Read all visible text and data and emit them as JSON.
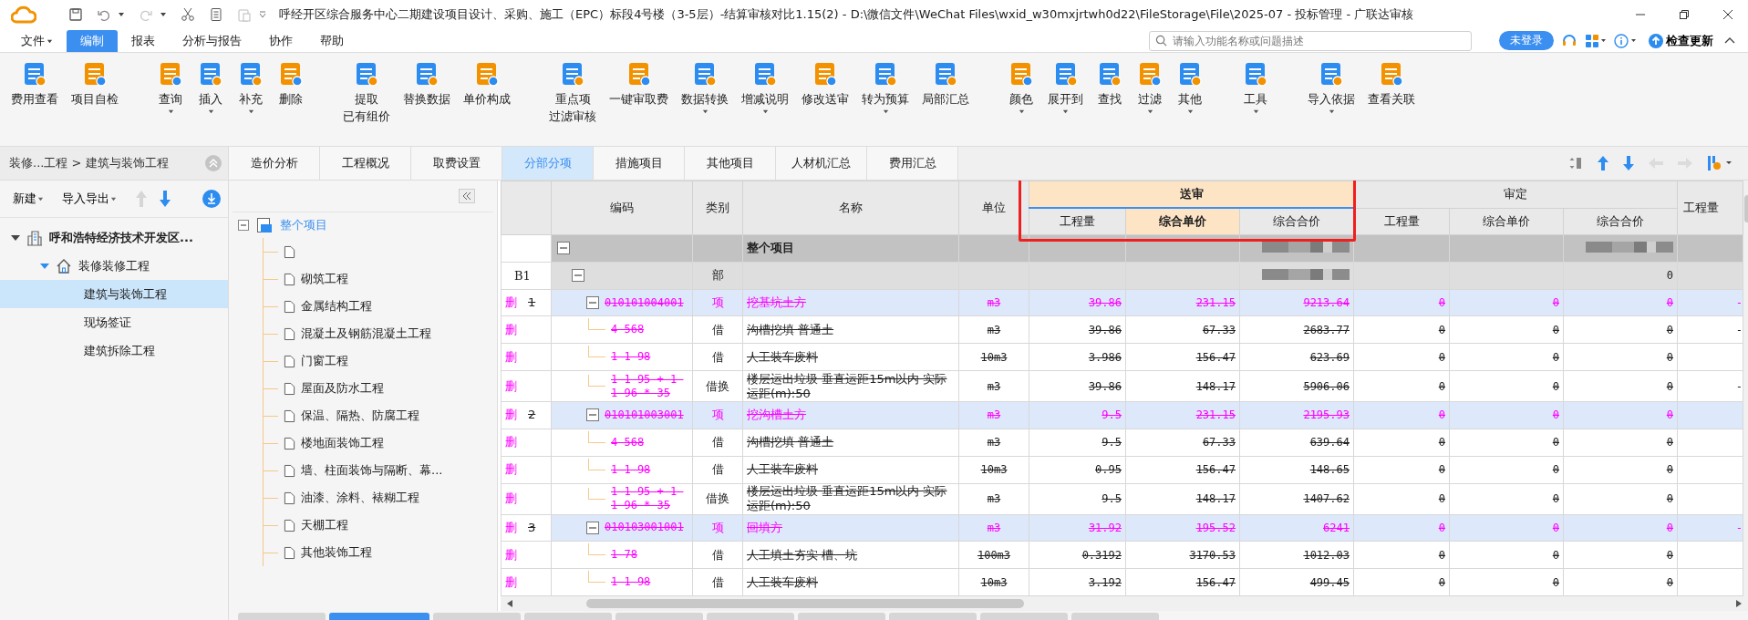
{
  "title_bar": {
    "title": "呼经开区综合服务中心二期建设项目设计、采购、施工（EPC）标段4号楼（3-5层）-结算审核对比1.15(2) - D:\\微信文件\\WeChat Files\\wxid_w30mxjrtwh0d22\\FileStorage\\File\\2025-07 - 投标管理 - 广联达审核",
    "redo_disabled": true
  },
  "menu": [
    {
      "label": "文件",
      "dropdown": true,
      "selected": false
    },
    {
      "label": "编制",
      "dropdown": false,
      "selected": true
    },
    {
      "label": "报表",
      "dropdown": false,
      "selected": false
    },
    {
      "label": "分析与报告",
      "dropdown": false,
      "selected": false
    },
    {
      "label": "协作",
      "dropdown": false,
      "selected": false
    },
    {
      "label": "帮助",
      "dropdown": false,
      "selected": false
    }
  ],
  "search": {
    "placeholder": "请输入功能名称或问题描述"
  },
  "login_button": "未登录",
  "update_button": "检查更新",
  "ribbon_groups": [
    [
      {
        "label": "费用查看",
        "dropdown": false
      },
      {
        "label": "项目自检",
        "dropdown": false
      }
    ],
    [
      {
        "label": "查询",
        "dropdown": true
      },
      {
        "label": "插入",
        "dropdown": true
      },
      {
        "label": "补充",
        "dropdown": true
      },
      {
        "label": "删除",
        "dropdown": false
      }
    ],
    [
      {
        "label": "提取",
        "second_line": "已有组价",
        "dropdown": false
      },
      {
        "label": "替换数据",
        "dropdown": false
      },
      {
        "label": "单价构成",
        "dropdown": false
      }
    ],
    [
      {
        "label": "重点项",
        "second_line": "过滤审核",
        "dropdown": false
      },
      {
        "label": "一键审取费",
        "dropdown": false
      },
      {
        "label": "数据转换",
        "dropdown": true
      },
      {
        "label": "增减说明",
        "dropdown": true
      },
      {
        "label": "修改送审",
        "dropdown": false
      },
      {
        "label": "转为预算",
        "dropdown": true
      },
      {
        "label": "局部汇总",
        "dropdown": false
      }
    ],
    [
      {
        "label": "颜色",
        "dropdown": true
      },
      {
        "label": "展开到",
        "dropdown": true
      },
      {
        "label": "查找",
        "dropdown": false
      },
      {
        "label": "过滤",
        "dropdown": true
      },
      {
        "label": "其他",
        "dropdown": true
      }
    ],
    [
      {
        "label": "工具",
        "dropdown": true
      }
    ],
    [
      {
        "label": "导入依据",
        "dropdown": true
      },
      {
        "label": "查看关联",
        "dropdown": false
      }
    ]
  ],
  "breadcrumb": "装修...工程 > 建筑与装饰工程",
  "left_toolbar": {
    "buttons": [
      {
        "label": "新建",
        "dropdown": true
      },
      {
        "label": "导入导出",
        "dropdown": true
      }
    ],
    "move_up_disabled": true,
    "move_down_disabled": false
  },
  "project_tree": [
    {
      "label": "呼和浩特经济技术开发区...",
      "kind": "project",
      "expanded": true,
      "selected": false,
      "children": [
        {
          "label": "装修装修工程",
          "kind": "unit",
          "expanded": true,
          "selected": false,
          "children": [
            {
              "label": "建筑与装饰工程",
              "kind": "leaf",
              "selected": true
            },
            {
              "label": "现场签证",
              "kind": "leaf",
              "selected": false
            },
            {
              "label": "建筑拆除工程",
              "kind": "leaf",
              "selected": false
            }
          ]
        }
      ]
    }
  ],
  "tabs": [
    {
      "label": "造价分析",
      "selected": false
    },
    {
      "label": "工程概况",
      "selected": false
    },
    {
      "label": "取费设置",
      "selected": false
    },
    {
      "label": "分部分项",
      "selected": true
    },
    {
      "label": "措施项目",
      "selected": false
    },
    {
      "label": "其他项目",
      "selected": false
    },
    {
      "label": "人材机汇总",
      "selected": false
    },
    {
      "label": "费用汇总",
      "selected": false
    }
  ],
  "table_toolbar": {
    "prev_disabled": true,
    "next_disabled": true
  },
  "division_tree": {
    "label": "整个项目",
    "expanded": true,
    "children": [
      {
        "kind": "untitled"
      },
      {
        "kind": "named",
        "label": "砌筑工程"
      },
      {
        "kind": "named",
        "label": "金属结构工程"
      },
      {
        "kind": "named",
        "label": "混凝土及钢筋混凝土工程"
      },
      {
        "kind": "named",
        "label": "门窗工程"
      },
      {
        "kind": "named",
        "label": "屋面及防水工程"
      },
      {
        "kind": "named",
        "label": "保温、隔热、防腐工程"
      },
      {
        "kind": "named",
        "label": "楼地面装饰工程"
      },
      {
        "kind": "named",
        "label": "墙、柱面装饰与隔断、幕..."
      },
      {
        "kind": "named",
        "label": "油漆、涂料、裱糊工程"
      },
      {
        "kind": "named",
        "label": "天棚工程"
      },
      {
        "kind": "named",
        "label": "其他装饰工程"
      }
    ]
  },
  "table": {
    "columns": [
      "编码",
      "类别",
      "名称",
      "单位"
    ],
    "groups": [
      {
        "label": "送审",
        "highlighted": true,
        "columns": [
          {
            "label": "工程量",
            "selected": false
          },
          {
            "label": "综合单价",
            "selected": true
          },
          {
            "label": "综合合价",
            "selected": false
          }
        ]
      },
      {
        "label": "审定",
        "highlighted": false,
        "columns": [
          {
            "label": "工程量",
            "selected": false
          },
          {
            "label": "综合单价",
            "selected": false
          },
          {
            "label": "综合合价",
            "selected": false
          }
        ]
      }
    ],
    "last_column": "工程量",
    "rows": [
      {
        "kind": "root",
        "name": "整个项目",
        "expanded": true,
        "sub_total_blurred": true,
        "app_total_blurred": true,
        "children": [
          {
            "kind": "section",
            "no": "B1",
            "type": "部",
            "expanded": true,
            "sub_total_blurred": true,
            "app_total": "0",
            "children": [
              {
                "kind": "item",
                "deleted": true,
                "mark": "删",
                "no": "1",
                "expanded": true,
                "code": "010101004001",
                "type": "项",
                "name": "挖基坑土方",
                "unit": "m3",
                "sub_qty": "39.86",
                "sub_price": "231.15",
                "sub_total": "9213.64",
                "app_qty": "0",
                "app_price": "0",
                "app_total": "0",
                "extra": "-",
                "children": [
                  {
                    "kind": "sub",
                    "deleted": true,
                    "mark": "删",
                    "code": "4-568",
                    "type": "借",
                    "name": "沟槽挖填 普通土",
                    "unit": "m3",
                    "sub_qty": "39.86",
                    "sub_price": "67.33",
                    "sub_total": "2683.77",
                    "app_qty": "0",
                    "app_price": "0",
                    "app_total": "0",
                    "extra": "-"
                  },
                  {
                    "kind": "sub",
                    "deleted": true,
                    "mark": "删",
                    "code": "1-1-98",
                    "type": "借",
                    "name": "人工装车废料",
                    "unit": "10m3",
                    "sub_qty": "3.986",
                    "sub_price": "156.47",
                    "sub_total": "623.69",
                    "app_qty": "0",
                    "app_price": "0",
                    "app_total": "0"
                  },
                  {
                    "kind": "sub",
                    "deleted": true,
                    "mark": "删",
                    "code": "1-1-95 + 1-1-96 * 35",
                    "type": "借换",
                    "name": "楼层运出垃圾 垂直运距15m以内 实际运距(m):50",
                    "unit": "m3",
                    "sub_qty": "39.86",
                    "sub_price": "148.17",
                    "sub_total": "5906.06",
                    "app_qty": "0",
                    "app_price": "0",
                    "app_total": "0",
                    "extra": "-"
                  }
                ]
              },
              {
                "kind": "item",
                "deleted": true,
                "mark": "删",
                "no": "2",
                "expanded": true,
                "code": "010101003001",
                "type": "项",
                "name": "挖沟槽土方",
                "unit": "m3",
                "sub_qty": "9.5",
                "sub_price": "231.15",
                "sub_total": "2195.93",
                "app_qty": "0",
                "app_price": "0",
                "app_total": "0",
                "children": [
                  {
                    "kind": "sub",
                    "deleted": true,
                    "mark": "删",
                    "code": "4-568",
                    "type": "借",
                    "name": "沟槽挖填 普通土",
                    "unit": "m3",
                    "sub_qty": "9.5",
                    "sub_price": "67.33",
                    "sub_total": "639.64",
                    "app_qty": "0",
                    "app_price": "0",
                    "app_total": "0"
                  },
                  {
                    "kind": "sub",
                    "deleted": true,
                    "mark": "删",
                    "code": "1-1-98",
                    "type": "借",
                    "name": "人工装车废料",
                    "unit": "10m3",
                    "sub_qty": "0.95",
                    "sub_price": "156.47",
                    "sub_total": "148.65",
                    "app_qty": "0",
                    "app_price": "0",
                    "app_total": "0"
                  },
                  {
                    "kind": "sub",
                    "deleted": true,
                    "mark": "删",
                    "code": "1-1-95 + 1-1-96 * 35",
                    "type": "借换",
                    "name": "楼层运出垃圾 垂直运距15m以内 实际运距(m):50",
                    "unit": "m3",
                    "sub_qty": "9.5",
                    "sub_price": "148.17",
                    "sub_total": "1407.62",
                    "app_qty": "0",
                    "app_price": "0",
                    "app_total": "0"
                  }
                ]
              },
              {
                "kind": "item",
                "deleted": true,
                "mark": "删",
                "no": "3",
                "expanded": true,
                "code": "010103001001",
                "type": "项",
                "name": "回填方",
                "unit": "m3",
                "sub_qty": "31.92",
                "sub_price": "195.52",
                "sub_total": "6241",
                "app_qty": "0",
                "app_price": "0",
                "app_total": "0",
                "extra": "-",
                "children": [
                  {
                    "kind": "sub",
                    "deleted": true,
                    "mark": "删",
                    "code": "1-78",
                    "type": "借",
                    "name": "人工填土夯实 槽、坑",
                    "unit": "100m3",
                    "sub_qty": "0.3192",
                    "sub_price": "3170.53",
                    "sub_total": "1012.03",
                    "app_qty": "0",
                    "app_price": "0",
                    "app_total": "0"
                  },
                  {
                    "kind": "sub",
                    "deleted": true,
                    "mark": "删",
                    "code": "1-1-98",
                    "type": "借",
                    "name": "人工装车废料",
                    "unit": "10m3",
                    "sub_qty": "3.192",
                    "sub_price": "156.47",
                    "sub_total": "499.45",
                    "app_qty": "0",
                    "app_price": "0",
                    "app_total": "0"
                  }
                ]
              }
            ]
          }
        ]
      }
    ]
  },
  "bottom_tabs": [
    {
      "selected": false
    },
    {
      "selected": true
    },
    {
      "selected": false
    },
    {
      "selected": false
    },
    {
      "selected": false
    },
    {
      "selected": false
    },
    {
      "selected": false
    },
    {
      "selected": false
    },
    {
      "selected": false
    },
    {
      "selected": false
    }
  ]
}
